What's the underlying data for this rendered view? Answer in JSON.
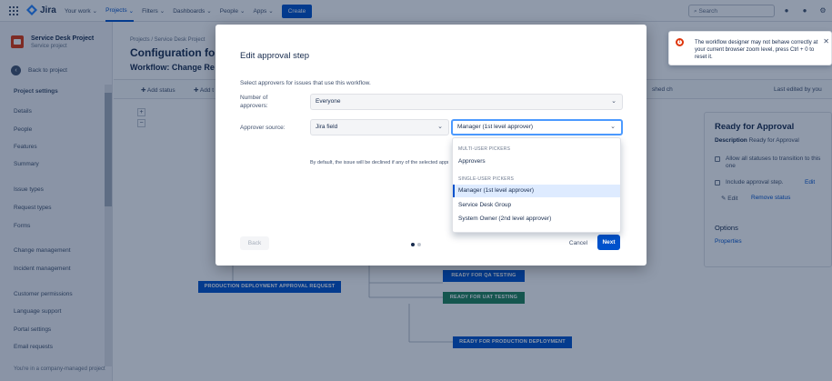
{
  "topnav": {
    "product": "Jira",
    "items": [
      "Your work",
      "Projects",
      "Filters",
      "Dashboards",
      "People",
      "Apps"
    ],
    "create_label": "Create",
    "search_placeholder": "Search"
  },
  "sidebar": {
    "project_name": "Service Desk Project",
    "project_type": "Service project",
    "back_label": "Back to project",
    "section_title": "Project settings",
    "items": [
      "Details",
      "People",
      "Features",
      "Summary",
      "Issue types",
      "Request types",
      "Forms",
      "Change management",
      "Incident management",
      "Customer permissions",
      "Language support",
      "Portal settings",
      "Email requests"
    ],
    "footer": "You're in a company-managed project"
  },
  "main": {
    "breadcrumb": "Projects  /  Service Desk Project",
    "title": "Configuration for",
    "workflow_title": "Workflow: Change Re",
    "toolbar": {
      "add_status": "Add status",
      "add_transition": "Add t",
      "published_fragment": "shed ch",
      "last_edited": "Last edited by you"
    },
    "zoom_in": "+",
    "zoom_out": "−",
    "statuses": {
      "production_approval": "PRODUCTION DEPLOYMENT APPROVAL REQUEST",
      "qa": "READY FOR QA TESTING",
      "uat": "READY FOR UAT TESTING",
      "prod": "READY FOR PRODUCTION DEPLOYMENT"
    }
  },
  "properties": {
    "title": "Ready for Approval",
    "desc_label": "Description",
    "desc_value": "Ready for Approval",
    "allow_all": "Allow all statuses to transition to this one",
    "include_approval": "Include approval step.",
    "edit_link": "Edit",
    "edit_label": "Edit",
    "remove_label": "Remove status",
    "options_title": "Options",
    "properties_link": "Properties"
  },
  "toast": {
    "message": "The workflow designer may not behave correctly at your current browser zoom level, press Ctrl + 0 to reset it."
  },
  "modal": {
    "title": "Edit approval step",
    "intro": "Select approvers for issues that use this workflow.",
    "number_label": "Number of approvers:",
    "number_value": "Everyone",
    "source_label": "Approver source:",
    "source_value": "Jira field",
    "field_value": "Manager (1st level approver)",
    "hint": "By default, the issue will be declined if any of the selected approve",
    "back_label": "Back",
    "cancel_label": "Cancel",
    "next_label": "Next"
  },
  "dropdown": {
    "group1": "MULTI-USER PICKERS",
    "group1_options": [
      "Approvers"
    ],
    "group2": "SINGLE-USER PICKERS",
    "group2_options": [
      "Manager (1st level approver)",
      "Service Desk Group",
      "System Owner (2nd level approver)"
    ],
    "selected": "Manager (1st level approver)"
  },
  "colors": {
    "brand": "#0052cc",
    "status_blue": "#0052cc",
    "status_green": "#1f845a",
    "error": "#de350b"
  }
}
